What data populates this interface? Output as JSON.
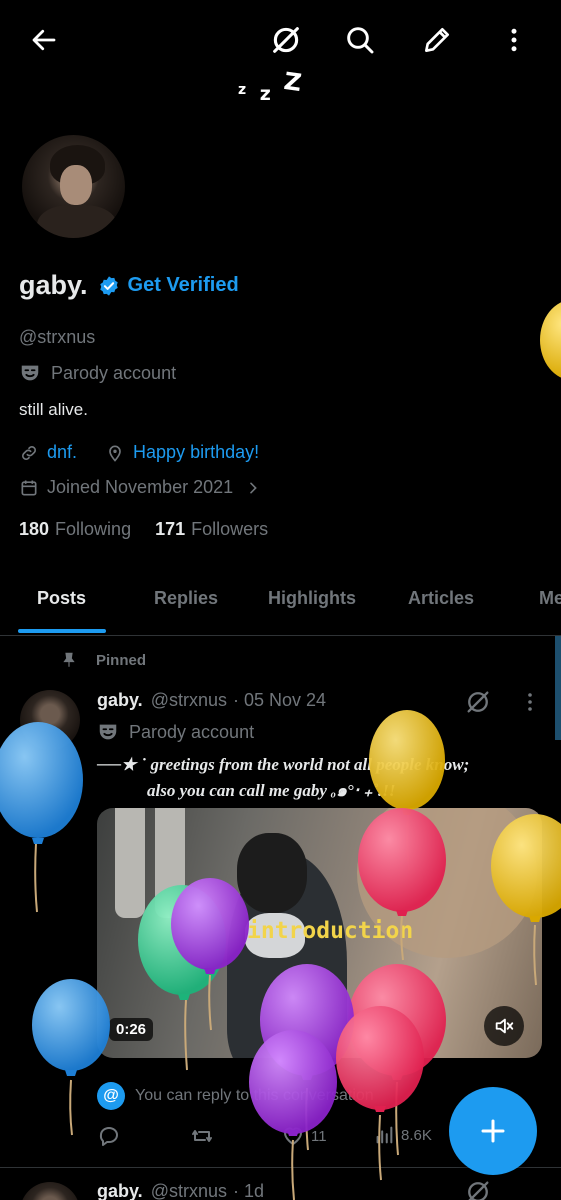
{
  "topbar": {
    "back_icon": "arrow-left-icon",
    "sleep_icon": "circle-slash-icon",
    "search_icon": "search-icon",
    "edit_icon": "pencil-icon",
    "more_icon": "more-vertical-icon",
    "zzz": [
      "z",
      "z",
      "Z"
    ]
  },
  "profile": {
    "name": "gaby.",
    "get_verified": "Get Verified",
    "handle": "@strxnus",
    "parody": "Parody account",
    "bio": "still alive.",
    "link": "dnf.",
    "location": "Happy birthday!",
    "joined": "Joined November 2021",
    "following_count": "180",
    "following_label": "Following",
    "followers_count": "171",
    "followers_label": "Followers"
  },
  "tabs": [
    "Posts",
    "Replies",
    "Highlights",
    "Articles",
    "Me"
  ],
  "active_tab": "Posts",
  "pinned_post": {
    "pinned_label": "Pinned",
    "name": "gaby.",
    "handle": "@strxnus",
    "date": "· 05 Nov 24",
    "parody": "Parody account",
    "text_line1": "──★ ˙ greetings from the world not all people know;",
    "text_line2": "also you can call me gaby ₒ๑°‧ ₊˚.!!",
    "video_caption": "introduction",
    "duration": "0:26",
    "reply_note": "You can reply to this conversation",
    "stats": {
      "likes": "11",
      "views": "8.6K"
    }
  },
  "next_post": {
    "name": "gaby.",
    "handle": "@strxnus",
    "date": "· 1d"
  },
  "colors": {
    "accent": "#1d9bf0",
    "muted": "#71767b",
    "text": "#e7e9ea",
    "background": "#000000"
  }
}
